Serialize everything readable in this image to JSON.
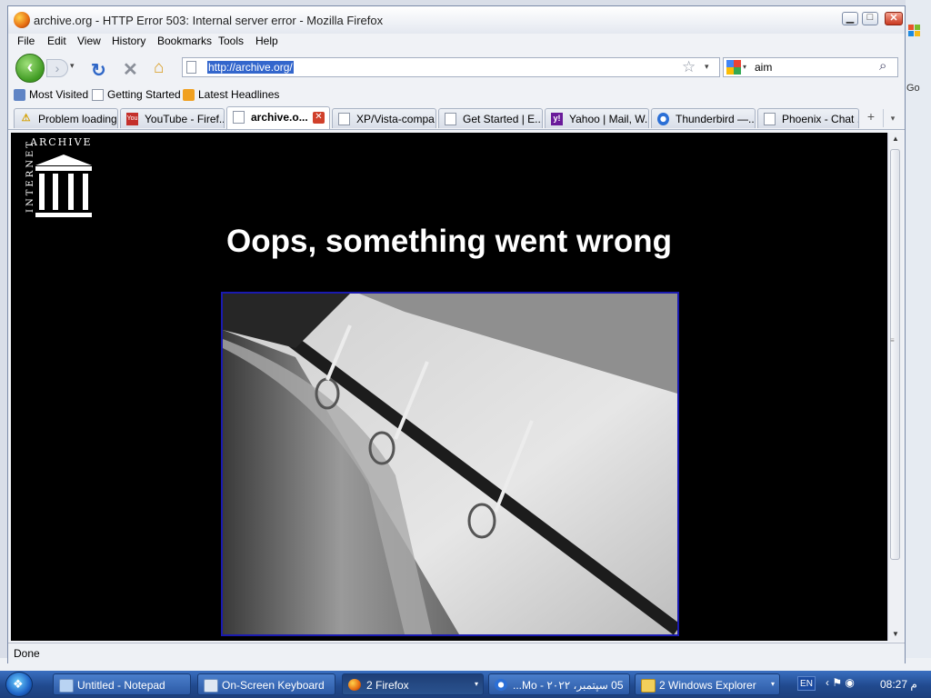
{
  "window": {
    "title": "archive.org - HTTP Error 503: Internal server error - Mozilla Firefox"
  },
  "window_controls": {
    "minimize": "▁",
    "maximize": "□",
    "close": "✕"
  },
  "menu": [
    "File",
    "Edit",
    "View",
    "History",
    "Bookmarks",
    "Tools",
    "Help"
  ],
  "nav": {
    "back_glyph": "‹",
    "forward_glyph": "›",
    "history_glyph": "▾",
    "reload_glyph": "↻",
    "stop_glyph": "✕",
    "home_glyph": "⌂",
    "url": "http://archive.org/",
    "star_glyph": "☆",
    "url_dropdown_glyph": "▾",
    "search_query": "aim",
    "search_dropdown_glyph": "▾",
    "search_glyph": "⌕"
  },
  "bookmarks": [
    "Most Visited",
    "Getting Started",
    "Latest Headlines"
  ],
  "tabs": [
    {
      "label": "Problem loading...",
      "icon": "warning-icon"
    },
    {
      "label": "YouTube - Firef...",
      "icon": "youtube-icon"
    },
    {
      "label": "archive.o...",
      "icon": "page-icon",
      "active": true
    },
    {
      "label": "XP/Vista-compa...",
      "icon": "page-icon"
    },
    {
      "label": "Get Started | E...",
      "icon": "page-icon"
    },
    {
      "label": "Yahoo | Mail, W...",
      "icon": "yahoo-icon"
    },
    {
      "label": "Thunderbird —...",
      "icon": "thunderbird-icon"
    },
    {
      "label": "Phoenix - Chat ...",
      "icon": "page-icon"
    }
  ],
  "tab_controls": {
    "new_tab_glyph": "+",
    "list_glyph": "▾",
    "close_glyph": "✕",
    "youtube_text": "You",
    "yahoo_text": "y!"
  },
  "page": {
    "logo_top": "ARCHIVE",
    "logo_side": "INTERNET",
    "error_heading": "Oops, something went wrong"
  },
  "scroll": {
    "up": "▲",
    "down": "▼",
    "grip": "≡"
  },
  "status": "Done",
  "desktop": {
    "go_label": "Go"
  },
  "taskbar": {
    "start_glyph": "❖",
    "items": [
      {
        "label": "Untitled - Notepad"
      },
      {
        "label": "On-Screen Keyboard"
      },
      {
        "label": "2 Firefox",
        "active": true
      },
      {
        "label": "‫05 سپتمبر، ٢٠٢٢ - Mo...‬"
      },
      {
        "label": "2 Windows Explorer"
      }
    ],
    "dropdown_glyph": "▾",
    "lang": "EN",
    "tray_icons": "‹ ⚑ ◉",
    "clock": "08:27 م"
  },
  "colors": {
    "accent": "#3366cc",
    "content_bg": "#000000",
    "image_border": "#1a1ab0",
    "taskbar": "#214a8f"
  }
}
